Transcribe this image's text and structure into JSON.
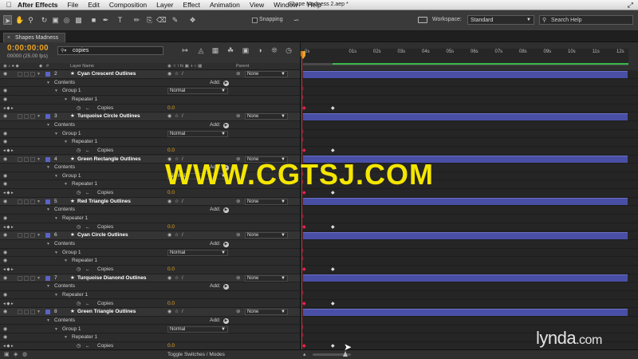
{
  "menubar": {
    "app": "After Effects",
    "items": [
      "File",
      "Edit",
      "Composition",
      "Layer",
      "Effect",
      "Animation",
      "View",
      "Window",
      "Help"
    ],
    "doc_title": "Shape Madness 2.aep *"
  },
  "toolbar": {
    "snapping": "Snapping",
    "workspace_label": "Workspace:",
    "workspace_value": "Standard",
    "help_placeholder": "Search Help"
  },
  "comp_tab": {
    "label": "Shapes Madness"
  },
  "timeline": {
    "timecode": "0:00:00:00",
    "fps": "00000 (25.00 fps)",
    "search_value": "copies",
    "col_layer_name": "Layer Name",
    "col_parent": "Parent",
    "ruler_ticks": [
      "0s",
      "01s",
      "02s",
      "03s",
      "04s",
      "05s",
      "06s",
      "07s",
      "08s",
      "09s",
      "10s",
      "11s",
      "12s"
    ],
    "toggle_label": "Toggle Switches / Modes"
  },
  "rows": [
    {
      "kind": "layer",
      "num": "2",
      "name": "Cyan Crescent Outlines",
      "parent": "None"
    },
    {
      "kind": "contents",
      "label": "Contents",
      "add": "Add:"
    },
    {
      "kind": "group",
      "label": "Group 1",
      "mode": "Normal"
    },
    {
      "kind": "repeater",
      "label": "Repeater 1"
    },
    {
      "kind": "copies",
      "label": "Copies",
      "value": "0.0"
    },
    {
      "kind": "layer",
      "num": "3",
      "name": "Turquoise Circle Outlines",
      "parent": "None"
    },
    {
      "kind": "contents",
      "label": "Contents",
      "add": "Add:"
    },
    {
      "kind": "group",
      "label": "Group 1",
      "mode": "Normal"
    },
    {
      "kind": "repeater",
      "label": "Repeater 1"
    },
    {
      "kind": "copies",
      "label": "Copies",
      "value": "0.0"
    },
    {
      "kind": "layer",
      "num": "4",
      "name": "Green Rectangle Outlines",
      "parent": "None"
    },
    {
      "kind": "contents",
      "label": "Contents",
      "add": "Add:"
    },
    {
      "kind": "group",
      "label": "Group 1",
      "mode": "Normal"
    },
    {
      "kind": "repeater",
      "label": "Repeater 1"
    },
    {
      "kind": "copies",
      "label": "Copies",
      "value": "0.0"
    },
    {
      "kind": "layer",
      "num": "5",
      "name": "Red Triangle Outlines",
      "parent": "None"
    },
    {
      "kind": "contents",
      "label": "Contents",
      "add": "Add:"
    },
    {
      "kind": "repeater2",
      "label": "Repeater 1"
    },
    {
      "kind": "copies",
      "label": "Copies",
      "value": "0.0"
    },
    {
      "kind": "layer",
      "num": "6",
      "name": "Cyan Circle Outlines",
      "parent": "None"
    },
    {
      "kind": "contents",
      "label": "Contents",
      "add": "Add:"
    },
    {
      "kind": "group",
      "label": "Group 1",
      "mode": "Normal"
    },
    {
      "kind": "repeater",
      "label": "Repeater 1"
    },
    {
      "kind": "copies",
      "label": "Copies",
      "value": "0.0"
    },
    {
      "kind": "layer",
      "num": "7",
      "name": "Turquoise Dianond Outlines",
      "parent": "None"
    },
    {
      "kind": "contents",
      "label": "Contents",
      "add": "Add:"
    },
    {
      "kind": "repeater2",
      "label": "Repeater 1"
    },
    {
      "kind": "copies",
      "label": "Copies",
      "value": "0.0"
    },
    {
      "kind": "layer",
      "num": "8",
      "name": "Green Triangle Outlines",
      "parent": "None"
    },
    {
      "kind": "contents",
      "label": "Contents",
      "add": "Add:"
    },
    {
      "kind": "group",
      "label": "Group 1",
      "mode": "Normal"
    },
    {
      "kind": "repeater",
      "label": "Repeater 1"
    },
    {
      "kind": "copies",
      "label": "Copies",
      "value": "0.0"
    }
  ],
  "overlay": {
    "watermark": "WWW.CGTSJ.COM",
    "lynda": "lynda",
    "lynda_suffix": ".com"
  },
  "colors": {
    "timecode": "#e8a326",
    "layer_bar": "#4a4fa6",
    "label": "#5a63c8",
    "watermark": "#f4e600"
  }
}
